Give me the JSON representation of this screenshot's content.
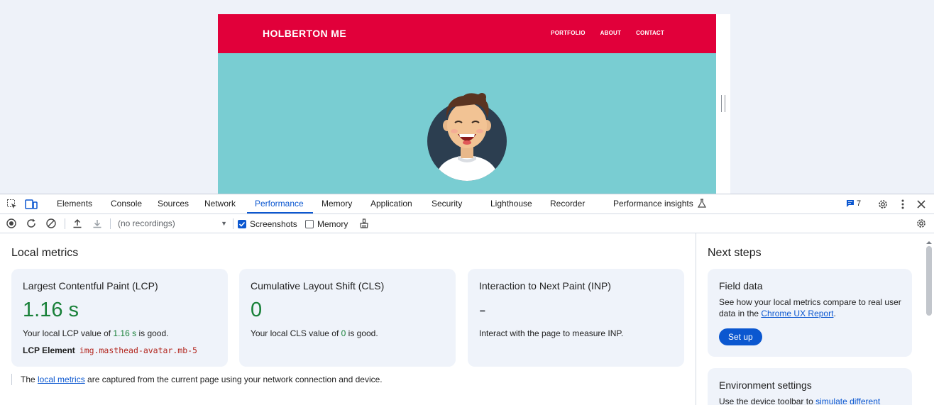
{
  "site": {
    "brand": "HOLBERTON ME",
    "nav": [
      "PORTFOLIO",
      "ABOUT",
      "CONTACT"
    ],
    "colors": {
      "header": "#e1003a",
      "hero": "#79cdd2"
    }
  },
  "devtools": {
    "tabs": [
      {
        "label": "Elements",
        "id": "elements"
      },
      {
        "label": "Console",
        "id": "console"
      },
      {
        "label": "Sources",
        "id": "sources"
      },
      {
        "label": "Network",
        "id": "network"
      },
      {
        "label": "Performance",
        "id": "performance",
        "active": true
      },
      {
        "label": "Memory",
        "id": "memory"
      },
      {
        "label": "Application",
        "id": "application"
      },
      {
        "label": "Security",
        "id": "security"
      },
      {
        "label": "Lighthouse",
        "id": "lighthouse"
      },
      {
        "label": "Recorder",
        "id": "recorder"
      },
      {
        "label": "Performance insights",
        "id": "performance-insights"
      }
    ],
    "issues_count": "7",
    "toolbar": {
      "recordings_placeholder": "(no recordings)",
      "screenshots_label": "Screenshots",
      "screenshots_checked": true,
      "memory_label": "Memory",
      "memory_checked": false
    },
    "local_metrics": {
      "title": "Local metrics",
      "cards": [
        {
          "title": "Largest Contentful Paint (LCP)",
          "value": "1.16 s",
          "desc_before": "Your local LCP value of ",
          "desc_value": "1.16 s",
          "desc_after": " is good.",
          "element_label": "LCP Element",
          "element_value": "img.masthead-avatar.mb-5"
        },
        {
          "title": "Cumulative Layout Shift (CLS)",
          "value": "0",
          "desc_before": "Your local CLS value of ",
          "desc_value": "0",
          "desc_after": " is good."
        },
        {
          "title": "Interaction to Next Paint (INP)",
          "value": "-",
          "desc_full": "Interact with the page to measure INP."
        }
      ],
      "footnote_before": "The ",
      "footnote_link": "local metrics",
      "footnote_after": " are captured from the current page using your network connection and device."
    },
    "next_steps": {
      "title": "Next steps",
      "field_data": {
        "title": "Field data",
        "desc_before": "See how your local metrics compare to real user data in the ",
        "desc_link": "Chrome UX Report",
        "desc_after": ".",
        "button": "Set up"
      },
      "environment": {
        "title": "Environment settings",
        "desc_before": "Use the device toolbar to ",
        "desc_link": "simulate different"
      }
    },
    "colors": {
      "accent": "#0b57d0",
      "good": "#188038"
    }
  }
}
